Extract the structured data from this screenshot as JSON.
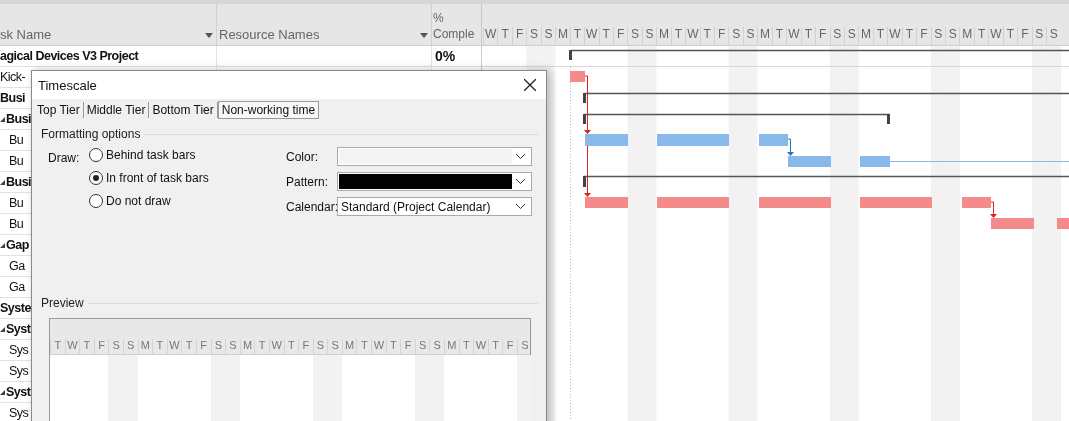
{
  "table": {
    "columns": [
      {
        "label": "sk Name",
        "filter": true
      },
      {
        "label": "Resource Names",
        "filter": true
      },
      {
        "label": "% Comple",
        "filter": false
      }
    ],
    "rows": [
      {
        "name": "agical Devices V3 Project",
        "complete": "0%",
        "children": [
          {
            "name": "Kick-"
          },
          {
            "name": "Busi",
            "children": [
              {
                "name": "Busi",
                "expanded": true,
                "children": [
                  {
                    "name": "Bu"
                  },
                  {
                    "name": "Bu"
                  }
                ]
              },
              {
                "name": "Busi",
                "expanded": true,
                "children": [
                  {
                    "name": "Bu"
                  },
                  {
                    "name": "Bu"
                  }
                ]
              },
              {
                "name": "Gap",
                "expanded": true,
                "children": [
                  {
                    "name": "Ga"
                  },
                  {
                    "name": "Ga"
                  }
                ]
              }
            ]
          },
          {
            "name": "Syste",
            "children": [
              {
                "name": "Syst",
                "expanded": true,
                "children": [
                  {
                    "name": "Sys"
                  },
                  {
                    "name": "Sys"
                  }
                ]
              },
              {
                "name": "Syst",
                "expanded": true,
                "children": [
                  {
                    "name": "Sys"
                  }
                ]
              }
            ]
          }
        ]
      }
    ]
  },
  "gantt": {
    "days": [
      "W",
      "T",
      "F",
      "S",
      "S",
      "M",
      "T",
      "W",
      "T",
      "F",
      "S",
      "S",
      "M",
      "T",
      "W",
      "T",
      "F",
      "S",
      "S",
      "M",
      "T",
      "W",
      "T",
      "F",
      "S",
      "S",
      "M",
      "T",
      "W",
      "T",
      "F",
      "S",
      "S",
      "M",
      "T",
      "W",
      "T",
      "F",
      "S",
      "S"
    ]
  },
  "dialog": {
    "title": "Timescale",
    "tabs": [
      {
        "label": "Top Tier",
        "selected": false
      },
      {
        "label": "Middle Tier",
        "selected": false
      },
      {
        "label": "Bottom Tier",
        "selected": false
      },
      {
        "label": "Non-working time",
        "selected": true
      }
    ],
    "group_title": "Formatting options",
    "draw_label": "Draw:",
    "draw_options": [
      {
        "label": "Behind task bars",
        "selected": false
      },
      {
        "label": "In front of task bars",
        "selected": true
      },
      {
        "label": "Do not draw",
        "selected": false
      }
    ],
    "fields": [
      {
        "label": "Color:",
        "kind": "swatch",
        "color": "#f4f4f4"
      },
      {
        "label": "Pattern:",
        "kind": "swatch",
        "color": "#000000"
      },
      {
        "label": "Calendar:",
        "kind": "text",
        "value": "Standard (Project Calendar)"
      }
    ],
    "preview_title": "Preview",
    "preview_days": [
      "T",
      "W",
      "T",
      "F",
      "S",
      "S",
      "M",
      "T",
      "W",
      "T",
      "F",
      "S",
      "S",
      "M",
      "T",
      "W",
      "T",
      "F",
      "S",
      "S",
      "M",
      "T",
      "W",
      "T",
      "F",
      "S",
      "S",
      "M",
      "T",
      "W",
      "T",
      "F",
      "S"
    ]
  }
}
